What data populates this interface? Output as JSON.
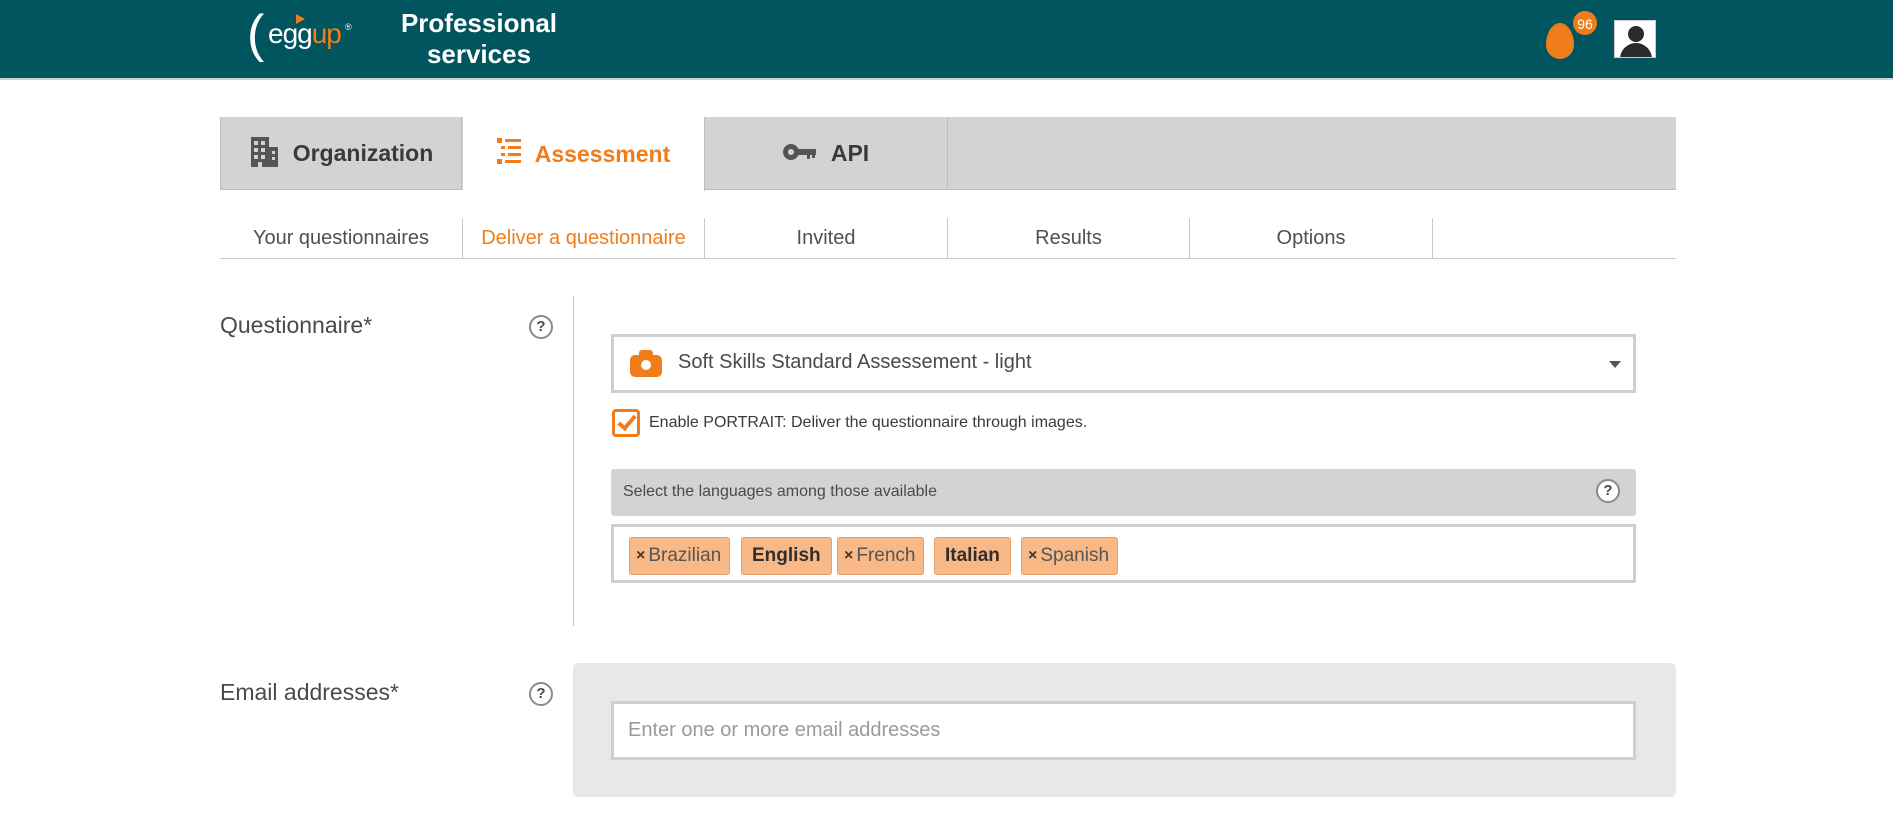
{
  "header": {
    "logo_text": "egg",
    "logo_text_accent": "up",
    "logo_bracket": "(",
    "logo_reg": "®",
    "title_line1": "Professional",
    "title_line2": "services",
    "notification_count": "96"
  },
  "main_tabs": [
    {
      "label": "Organization",
      "icon": "building-icon"
    },
    {
      "label": "Assessment",
      "icon": "list-icon",
      "active": true
    },
    {
      "label": "API",
      "icon": "key-icon"
    }
  ],
  "sub_tabs": [
    {
      "label": "Your questionnaires"
    },
    {
      "label": "Deliver a questionnaire",
      "active": true
    },
    {
      "label": "Invited"
    },
    {
      "label": "Results"
    },
    {
      "label": "Options"
    }
  ],
  "form": {
    "questionnaire": {
      "label": "Questionnaire*",
      "help": "?",
      "selected": "Soft Skills Standard Assessement - light",
      "portrait_checked": true,
      "portrait_label": "Enable PORTRAIT: Deliver the questionnaire through images.",
      "languages_label": "Select the languages among those available",
      "languages_help": "?",
      "languages": [
        {
          "label": "Brazilian",
          "removable": true
        },
        {
          "label": "English",
          "removable": false
        },
        {
          "label": "French",
          "removable": true
        },
        {
          "label": "Italian",
          "removable": false
        },
        {
          "label": "Spanish",
          "removable": true
        }
      ],
      "remove_glyph": "×"
    },
    "email": {
      "label": "Email addresses*",
      "help": "?",
      "placeholder": "Enter one or more email addresses",
      "value": ""
    }
  },
  "colors": {
    "header_bg": "#00555e",
    "accent": "#f07d1a",
    "tag_bg": "#f9b986",
    "tab_bg": "#d3d3d3"
  }
}
